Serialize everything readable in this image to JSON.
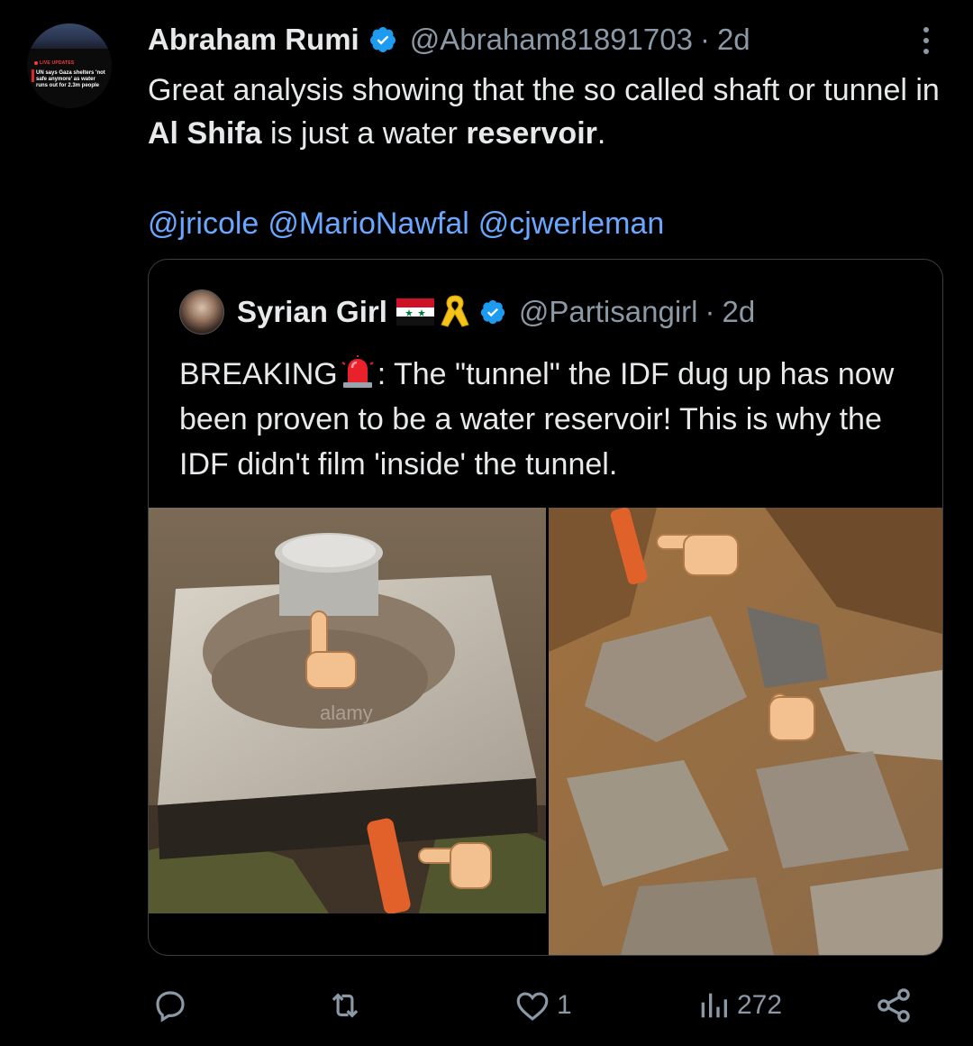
{
  "author": {
    "name": "Abraham Rumi",
    "handle": "@Abraham81891703",
    "separator": "·",
    "time": "2d",
    "verified": true,
    "avatar": {
      "live_label": "LIVE UPDATES",
      "headline": "UN says Gaza shelters 'not safe anymore' as water runs out for 2.3m people"
    }
  },
  "tweet": {
    "text_part1": "Great analysis showing that the so called shaft or tunnel in ",
    "bold1": "Al Shifa",
    "text_part2": " is just a water ",
    "bold2": "reservoir",
    "text_part3": ".",
    "mentions": [
      "@jricole",
      "@MarioNawfal",
      "@cjwerleman"
    ]
  },
  "quoted": {
    "name": "Syrian Girl",
    "handle": "@Partisangirl",
    "separator": "·",
    "time": "2d",
    "emojis": [
      "syria-flag",
      "yellow-ribbon"
    ],
    "verified": true,
    "text_lead": "BREAKING",
    "text_body": ": The \"tunnel\" the IDF dug up has now been proven to be a water reservoir! This is why the IDF didn't film 'inside' the tunnel.",
    "images": [
      {
        "alt": "concrete water tank with pointing finger emojis"
      },
      {
        "alt": "rubble and dirt with pointing finger emojis"
      }
    ]
  },
  "actions": {
    "reply": {
      "icon": "reply-icon",
      "count": ""
    },
    "repost": {
      "icon": "repost-icon",
      "count": ""
    },
    "like": {
      "icon": "heart-icon",
      "count": "1"
    },
    "views": {
      "icon": "views-icon",
      "count": "272"
    },
    "share": {
      "icon": "share-icon",
      "count": ""
    }
  },
  "colors": {
    "background": "#000000",
    "text": "#e7e9ea",
    "muted": "#8b98a5",
    "link": "#6aa7ff",
    "verified": "#1d9bf0"
  }
}
